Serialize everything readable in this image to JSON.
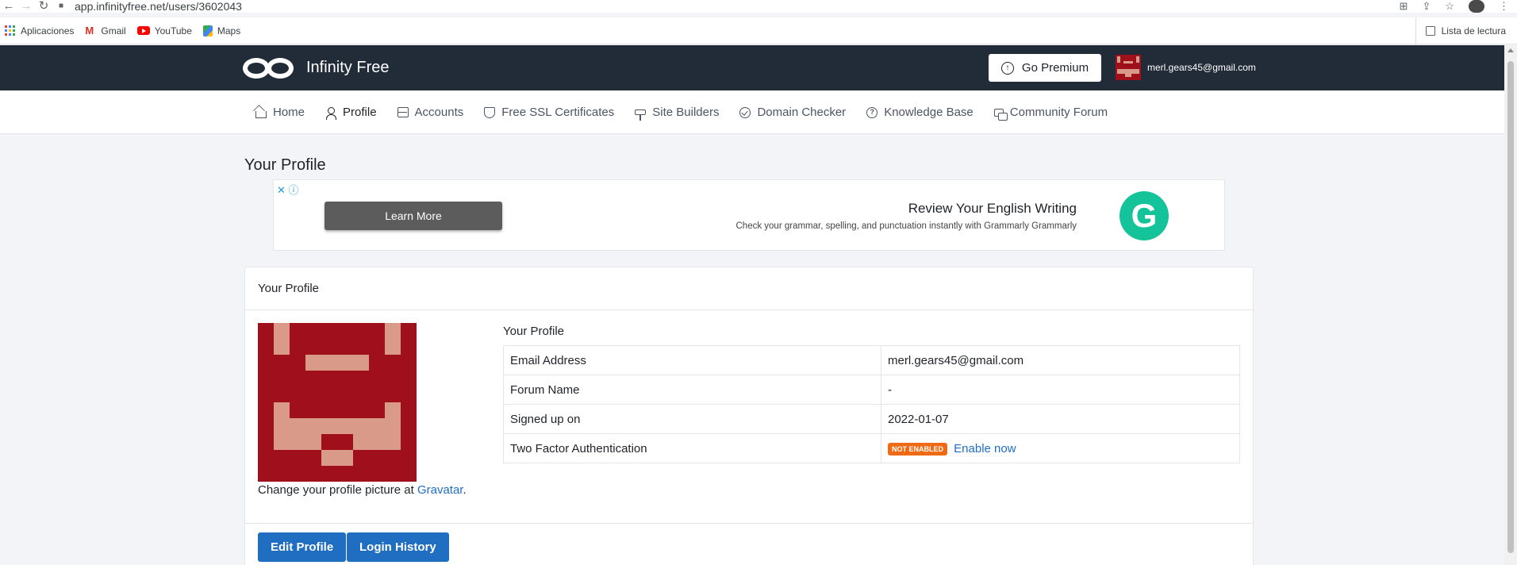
{
  "browser": {
    "url": "app.infinityfree.net/users/3602043",
    "bookmarks": [
      "Aplicaciones",
      "Gmail",
      "YouTube",
      "Maps"
    ],
    "reading_list": "Lista de lectura"
  },
  "header": {
    "brand": "Infinity Free",
    "premium_label": "Go Premium",
    "user_email": "merl.gears45@gmail.com"
  },
  "nav": {
    "items": [
      {
        "label": "Home",
        "icon": "home-icon"
      },
      {
        "label": "Profile",
        "icon": "user-icon"
      },
      {
        "label": "Accounts",
        "icon": "server-icon"
      },
      {
        "label": "Free SSL Certificates",
        "icon": "shield-icon"
      },
      {
        "label": "Site Builders",
        "icon": "paint-roller-icon"
      },
      {
        "label": "Domain Checker",
        "icon": "check-circle-icon"
      },
      {
        "label": "Knowledge Base",
        "icon": "help-circle-icon"
      },
      {
        "label": "Community Forum",
        "icon": "forum-icon"
      }
    ],
    "active": "Profile"
  },
  "page": {
    "title": "Your Profile"
  },
  "ad": {
    "button": "Learn More",
    "headline": "Review Your English Writing",
    "subtext": "Check your grammar, spelling, and punctuation instantly with Grammarly Grammarly",
    "close": "✕ ⓘ",
    "logo_letter": "G"
  },
  "profile": {
    "card_title": "Your Profile",
    "section_title": "Your Profile",
    "caption_prefix": "Change your profile picture at ",
    "caption_link": "Gravatar",
    "caption_suffix": ".",
    "rows": [
      {
        "label": "Email Address",
        "value": "merl.gears45@gmail.com"
      },
      {
        "label": "Forum Name",
        "value": "-"
      },
      {
        "label": "Signed up on",
        "value": "2022-01-07"
      },
      {
        "label": "Two Factor Authentication",
        "badge": "NOT ENABLED",
        "link": "Enable now"
      }
    ],
    "edit_button": "Edit Profile",
    "history_button": "Login History"
  },
  "colors": {
    "header_bg": "#222b38",
    "primary": "#1f6ec2",
    "badge": "#f06a14",
    "gravatar_bg": "#a0101c",
    "gravatar_fg": "#d99a8a",
    "grammarly": "#15c39a"
  }
}
